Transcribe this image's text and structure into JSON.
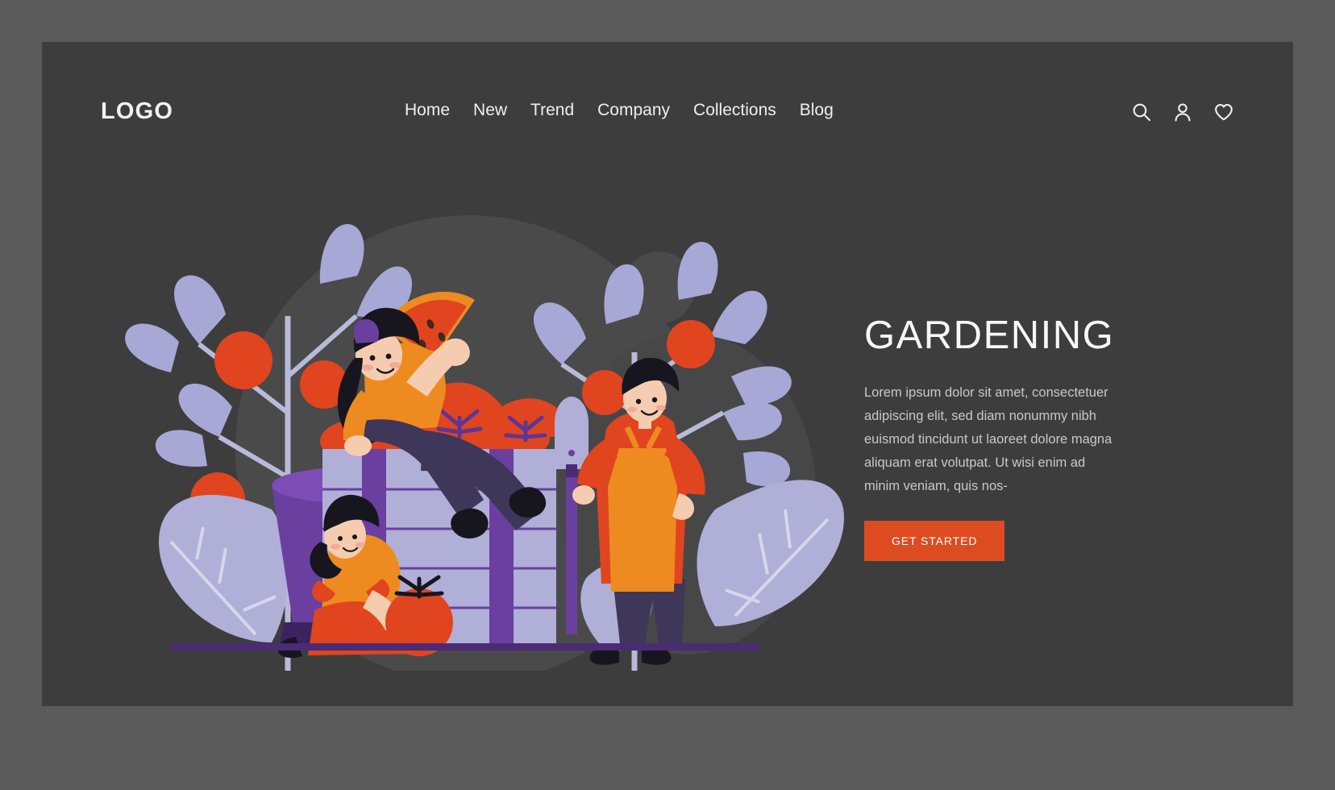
{
  "colors": {
    "outer_frame": "#5a5a5a",
    "panel_bg": "#3d3d3d",
    "accent_orange": "#dd4b20",
    "tomato_red": "#e0451f",
    "leaf_periwinkle": "#a7a8d6",
    "box_lilac": "#b0afd8",
    "box_purple": "#6b3fa0",
    "shirt_orange": "#ee8b20",
    "text_light": "#efefef",
    "text_muted": "#c8c8c8"
  },
  "header": {
    "logo": "LOGO",
    "nav": [
      {
        "label": "Home",
        "name": "nav-item-home"
      },
      {
        "label": "New",
        "name": "nav-item-new"
      },
      {
        "label": "Trend",
        "name": "nav-item-trend"
      },
      {
        "label": "Company",
        "name": "nav-item-company"
      },
      {
        "label": "Collections",
        "name": "nav-item-collections"
      },
      {
        "label": "Blog",
        "name": "nav-item-blog"
      }
    ],
    "icons": [
      {
        "name": "search-icon",
        "label": "Search"
      },
      {
        "name": "user-icon",
        "label": "Account"
      },
      {
        "name": "heart-icon",
        "label": "Favorites"
      }
    ]
  },
  "hero": {
    "title": "GARDENING",
    "paragraph": "Lorem ipsum dolor sit amet, consectetuer adipiscing elit, sed diam nonummy nibh euismod tincidunt ut laoreet dolore magna aliquam erat volutpat. Ut wisi enim ad minim veniam, quis nos-",
    "cta_label": "GET STARTED"
  },
  "illustration": {
    "name": "gardening-illustration",
    "alt": "Three people harvesting tomatoes into a large crate with tomato plants and a shovel",
    "elements": [
      "tomato-plant-left",
      "tomato-plant-right",
      "large-leaf-left",
      "large-leaf-right",
      "crate",
      "woman-sitting-on-crate",
      "woman-with-tomato",
      "man-with-shovel",
      "bucket",
      "ground-line"
    ]
  }
}
